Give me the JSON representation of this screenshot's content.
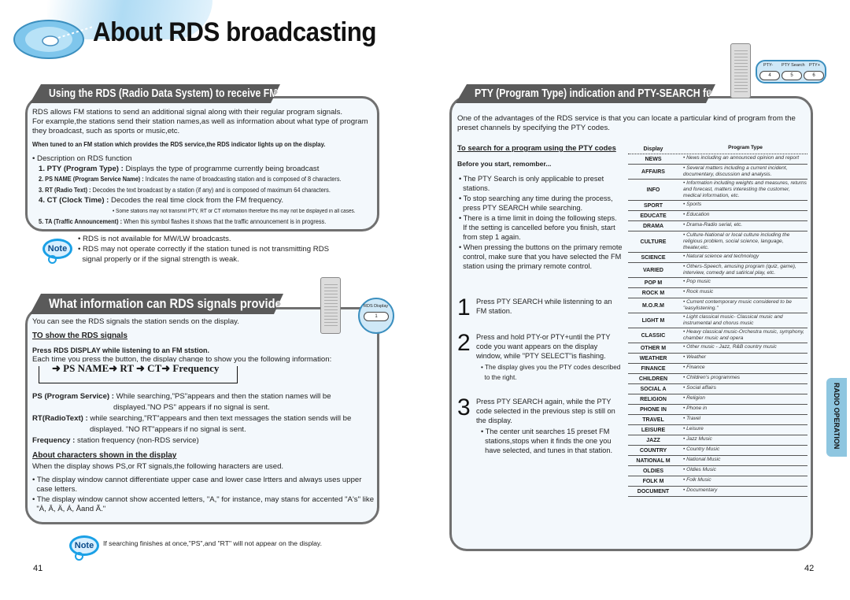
{
  "title": "About RDS broadcasting",
  "left_page": {
    "section1": {
      "heading": "Using the RDS (Radio Data System) to receive FM stations",
      "intro1": "RDS allows FM stations to send an additional signal along with their regular program signals.",
      "intro2": "For example,the stations send their station names,as well as information about what  type of program",
      "intro3": "they broadcast, such as sports or music,etc.",
      "bold_line": "When tuned to an FM station which provides the RDS service,the RDS indicator lights up on the display.",
      "desc_bullet": "• Description on RDS function",
      "items": [
        {
          "label": "1. PTY (Program Type) :",
          "text": " Displays the type of programme currently being broadcast"
        },
        {
          "label": "2. PS NAME (Program Service Name) :",
          "text": " Indicates the name of broadcasting station and is composed of 8 characters."
        },
        {
          "label": "3. RT (Radio Text) :",
          "text": " Decodes the text broadcast by a station (if any) and is composed of maximum 64 characters."
        },
        {
          "label": "4. CT (Clock Time) :",
          "text": " Decodes the real time clock from the FM frequency."
        },
        {
          "label": "5. TA (Traffic Announcement) :",
          "text": " When this symbol flashes it shows that the traffic announcement is in progress."
        }
      ],
      "ct_note": "• Some stations may not transmit PTY, RT or CT information therefore this may not be displayed in all cases."
    },
    "note1": {
      "badge": "Note",
      "lines": [
        "• RDS is not available for MW/LW broadcasts.",
        "• RDS may not operate correctly if the station tuned is not transmitting RDS",
        "  signal properly or if the signal strength is weak."
      ]
    },
    "section2": {
      "heading": "What information can RDS signals provide?",
      "intro": "You can see the RDS signals the station sends on the display.",
      "subheading": "TO show the RDS signals",
      "press_line": "Press RDS DISPLAY while listening to an FM ststion.",
      "each_time": "Each time you press the button, the display change to show you the following information:",
      "sequence": "➜ PS NAME➜ RT ➜ CT➜ Frequency",
      "ps_label": "PS (Program Service) :",
      "ps_text1": " While searching,\"PS\"appears and then the station names will be",
      "ps_text2": "displayed.\"NO PS\" appears if no signal is sent.",
      "rt_label": "RT(RadioText) :",
      "rt_text1": " while searching,\"RT\"appears and then text messages the station sends will be",
      "rt_text2": "displayed. \"NO RT\"appears if no signal is sent.",
      "freq_label": "Frequency :",
      "freq_text": " station frequency (non-RDS service)",
      "chars_heading": "About characters shown in the display",
      "chars_intro": "When the display shows PS,or RT signals,the following haracters are used.",
      "chars_b1a": "• The display window cannot differentiate upper case and lower case lrtters and always uses upper",
      "chars_b1b": "  case letters.",
      "chars_b2a": "• The display window  cannot show accented letters, \"A,\" for instance, may stans for accented \"A's\" like",
      "chars_b2b": "  \"À, Â, Ä, Á, Åand Ã.\"",
      "remote_button_label": "RDS Display",
      "remote_button_key": "1"
    },
    "note2": {
      "badge": "Note",
      "text": "If searching finishes at once,\"PS\",and \"RT\" will not appear on the display."
    },
    "page_number": "41"
  },
  "right_page": {
    "section": {
      "heading": "PTY (Program Type) indication and PTY-SEARCH function",
      "intro1": "One  of the advantages of the RDS service is that you can locate a particular kind of program from the",
      "intro2": "preset channels by specifying the PTY codes.",
      "subheading": "To search for a program using the PTY codes",
      "before": "Before you start, remomber...",
      "bullets": [
        [
          "• The PTY Search is only applicable to preset",
          "  stations."
        ],
        [
          "• To stop searching any time during the process,",
          "  press PTY SEARCH while searching."
        ],
        [
          "• There is a time limit in doing the following steps.",
          "  If the setting is cancelled before you finish, start",
          "  from step 1 again."
        ],
        [
          "• When pressing the buttons on the primary remote",
          "  control, make sure that you have selected the FM",
          "  station using the primary remote control."
        ]
      ],
      "steps": [
        {
          "num": "1",
          "lines": [
            "Press PTY SEARCH while listenning to an",
            "FM station."
          ],
          "sub": []
        },
        {
          "num": "2",
          "lines": [
            "Press and hold PTY-or PTY+until the PTY",
            "code you want appears on the display",
            "window, while \"PTY SELECT\"is flashing."
          ],
          "sub": [
            "• The display gives you the PTY codes described",
            "  to the right."
          ]
        },
        {
          "num": "3",
          "lines": [
            "Press PTY SEARCH again, while the PTY",
            "code selected in the previous step is still on",
            "the display."
          ],
          "sub": [
            "• The center unit searches 15 preset FM",
            "  stations,stops when it finds the one you",
            "  have selected, and tunes in that station."
          ]
        }
      ],
      "remote_keys": [
        {
          "label": "PTY-",
          "key": "4"
        },
        {
          "label": "PTY Search",
          "key": "5"
        },
        {
          "label": "PTY+",
          "key": "6"
        }
      ]
    },
    "pty_table": {
      "headers": [
        "Display",
        "Program Type"
      ],
      "rows": [
        {
          "display": "NEWS",
          "type": "• News including an announced opinion and report"
        },
        {
          "display": "AFFAIRS",
          "type": "• Several matters including a current incident, documentary, discussion and analysis."
        },
        {
          "display": "INFO",
          "type": "•  Information including weights and measures, returns and forecast, matters interesting the customer, medical information, etc."
        },
        {
          "display": "SPORT",
          "type": "• Sports"
        },
        {
          "display": "EDUCATE",
          "type": "• Education"
        },
        {
          "display": "DRAMA",
          "type": "• Drama-Radio serial, etc."
        },
        {
          "display": "CULTURE",
          "type": "• Culture-National or local culture including the religious problem, social science, language, theater,etc."
        },
        {
          "display": "SCIENCE",
          "type": "• Natural science and technology"
        },
        {
          "display": "VARIED",
          "type": "• Others-Speech, amusing program (quiz, game), interview, comedy and satirical play, etc."
        },
        {
          "display": "POP M",
          "type": "• Pop music"
        },
        {
          "display": "ROCK M",
          "type": "• Rock music"
        },
        {
          "display": "M.O.R.M",
          "type": "• Current contemporary music considered to be \"easylistening.\""
        },
        {
          "display": "LIGHT M",
          "type": "• Light classical music- Classical music and instrumental and chorus music"
        },
        {
          "display": "CLASSIC",
          "type": "• Heavy classical  music-Orchestra music, symphony, chamber music and opera"
        },
        {
          "display": "OTHER M",
          "type": "• Other music - Jazz, R&B country music"
        },
        {
          "display": "WEATHER",
          "type": "• Weather"
        },
        {
          "display": "FINANCE",
          "type": "• Finance"
        },
        {
          "display": "CHILDREN",
          "type": "• Children's programmes"
        },
        {
          "display": "SOCIAL A",
          "type": "• Social affairs"
        },
        {
          "display": "RELIGION",
          "type": "• Religion"
        },
        {
          "display": "PHONE IN",
          "type": "• Phone in"
        },
        {
          "display": "TRAVEL",
          "type": "• Travel"
        },
        {
          "display": "LEISURE",
          "type": "• Leisure"
        },
        {
          "display": "JAZZ",
          "type": "• Jazz Music"
        },
        {
          "display": "COUNTRY",
          "type": "• Country Music"
        },
        {
          "display": "NATIONAL M",
          "type": "• National Music"
        },
        {
          "display": "OLDIES",
          "type": "• Oldies Music"
        },
        {
          "display": "FOLK M",
          "type": "• Folk Music"
        },
        {
          "display": "DOCUMENT",
          "type": "• Documentary"
        }
      ]
    },
    "side_tab": "RADIO OPERATION",
    "page_number": "42"
  }
}
